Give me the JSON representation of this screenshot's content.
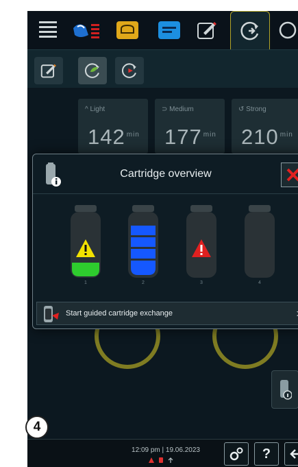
{
  "tabs": [
    {
      "icon": "menu-lines-icon"
    },
    {
      "icon": "cleaning-icon"
    },
    {
      "icon": "baking-icon"
    },
    {
      "icon": "card-icon"
    },
    {
      "icon": "edit-icon"
    },
    {
      "icon": "care-icon",
      "active": true
    },
    {
      "icon": "more-icon"
    }
  ],
  "subtoolbar": [
    {
      "icon": "edit-icon"
    },
    {
      "icon": "care-refresh-icon",
      "active": true
    },
    {
      "icon": "care-forward-icon"
    }
  ],
  "programs": [
    {
      "label": "Light",
      "value": "142",
      "unit": "min"
    },
    {
      "label": "Medium",
      "value": "177",
      "unit": "min"
    },
    {
      "label": "Strong",
      "value": "210",
      "unit": "min"
    }
  ],
  "dialog": {
    "title": "Cartridge overview",
    "close_icon": "close-x-icon",
    "info_icon": "cartridge-info-icon",
    "cartridges": [
      {
        "number": "1",
        "status": "warning",
        "fill_color": "#2ecc2e",
        "warning_color": "#f2e200",
        "fill_level": 0.2
      },
      {
        "number": "2",
        "status": "full",
        "fill_color": "#1558ff",
        "fill_level": 0.85
      },
      {
        "number": "3",
        "status": "error",
        "warning_color": "#e02020",
        "fill_level": 0
      },
      {
        "number": "4",
        "status": "empty",
        "fill_level": 0
      }
    ],
    "action": {
      "label": "Start guided cartridge exchange",
      "chevron": ">"
    }
  },
  "bottom": {
    "step_number": "4",
    "datetime": "12:09 pm | 19.06.2023",
    "buttons": [
      {
        "icon": "settings-gears-icon"
      },
      {
        "label": "?"
      },
      {
        "icon": "back-arrow-icon"
      }
    ]
  },
  "colors": {
    "accent": "#b3a629",
    "background": "#0c1820",
    "danger": "#e02020",
    "warning": "#f2e200"
  }
}
